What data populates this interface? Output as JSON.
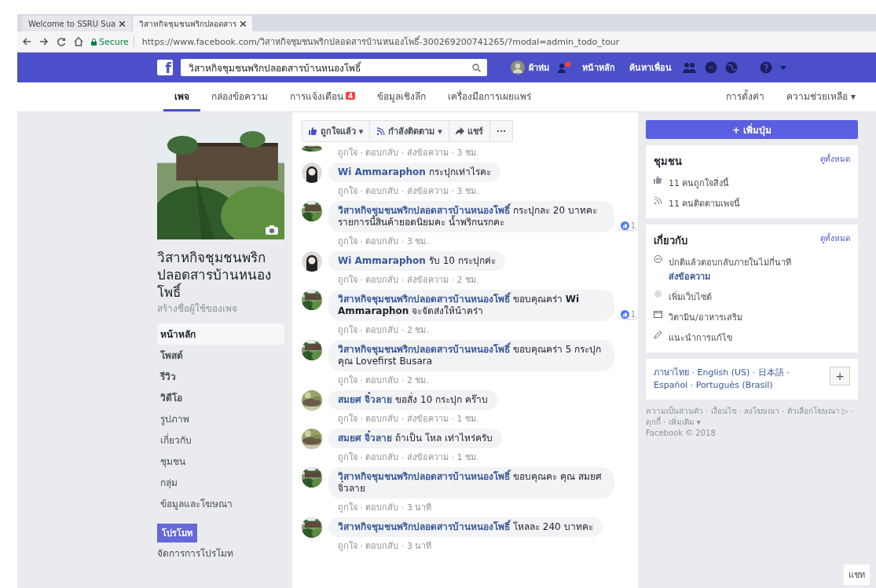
{
  "browser": {
    "tabs": [
      {
        "title": "Welcome to SSRU Sua",
        "selected": false
      },
      {
        "title": "วิสาหกิจชุมชนพริกปลอดสาร",
        "selected": true
      }
    ],
    "secure_label": "Secure",
    "url": "https://www.facebook.com/วิสาหกิจชุมชนพริกปลอดสารบ้านหนองโพธิ์-300269200741265/?modal=admin_todo_tour"
  },
  "topbar": {
    "logo": "f",
    "search_value": "วิสาหกิจชุมชนพริกปลอดสารบ้านหนองโพธิ์",
    "user": "ผ้าห่ม",
    "links": [
      "หน้าหลัก",
      "ค้นหาเพื่อน"
    ]
  },
  "page_tabs": [
    {
      "label": "เพจ",
      "selected": true
    },
    {
      "label": "กล่องข้อความ",
      "selected": false
    },
    {
      "label": "การแจ้งเตือน",
      "selected": false,
      "badge": "4"
    },
    {
      "label": "ข้อมูลเชิงลึก",
      "selected": false
    },
    {
      "label": "เครื่องมือการเผยแพร่",
      "selected": false
    }
  ],
  "page_tabs_right": [
    "การตั้งค่า",
    "ความช่วยเหลือ ▾"
  ],
  "sidebar": {
    "page_name": "วิสาหกิจชุมชนพริกปลอดสารบ้านหนองโพธิ์",
    "username_hint": "สร้างชื่อผู้ใช้ของเพจ",
    "items": [
      {
        "label": "หน้าหลัก",
        "selected": true
      },
      {
        "label": "โพสต์",
        "selected": false
      },
      {
        "label": "รีวิว",
        "selected": false
      },
      {
        "label": "วิดีโอ",
        "selected": false
      },
      {
        "label": "รูปภาพ",
        "selected": false
      },
      {
        "label": "เกี่ยวกับ",
        "selected": false
      },
      {
        "label": "ชุมชน",
        "selected": false
      },
      {
        "label": "กลุ่ม",
        "selected": false
      },
      {
        "label": "ข้อมูลและโฆษณา",
        "selected": false
      }
    ],
    "promote_button": "โปรโมท",
    "manage_promotions": "จัดการการโปรโมท"
  },
  "actions": [
    {
      "kind": "like",
      "label": "ถูกใจแล้ว ▾"
    },
    {
      "kind": "follow",
      "label": "กำลังติดตาม ▾"
    },
    {
      "kind": "share",
      "label": "แชร์"
    },
    {
      "kind": "more",
      "label": "···"
    }
  ],
  "comments": [
    {
      "kind": "page",
      "meta": "ถูกใจ · ตอบกลับ · ส่งข้อความ · 3 ชม."
    },
    {
      "kind": "person",
      "author": "Wi Ammaraphon",
      "text": "กระปุกเท่าไรคะ",
      "meta": "ถูกใจ · ตอบกลับ · ส่งข้อความ · 3 ชม."
    },
    {
      "kind": "page",
      "author": "วิสาหกิจชุมชนพริกปลอดสารบ้านหนองโพธิ์",
      "text": "กระปุกละ 20 บาทคะ รายการนี้สินค้ายอดนิยมคะ น้ำพริกนรกคะ",
      "meta": "ถูกใจ · ตอบกลับ · 3 ชม.",
      "likes": "1"
    },
    {
      "kind": "person",
      "author": "Wi Ammaraphon",
      "text": "รับ 10 กระปุกค่ะ",
      "meta": "ถูกใจ · ตอบกลับ · ส่งข้อความ · 2 ชม."
    },
    {
      "kind": "page",
      "author": "วิสาหกิจชุมชนพริกปลอดสารบ้านหนองโพธิ์",
      "text": "ขอบคุณคร่า **Wi Ammaraphon** จะจัดส่งให้น้าคร่า",
      "meta": "ถูกใจ · ตอบกลับ · 2 ชม.",
      "likes": "1"
    },
    {
      "kind": "page",
      "author": "วิสาหกิจชุมชนพริกปลอดสารบ้านหนองโพธิ์",
      "text": "ขอบคุณคร่า 5 กระปุก คุณ Lovefirst Busara",
      "meta": "ถูกใจ · ตอบกลับ · 2 ชม."
    },
    {
      "kind": "user",
      "author": "สมยศ จิ๋วลาย",
      "text": "ขอสั่ง 10 กระปุก คร๊าบ",
      "meta": "ถูกใจ · ตอบกลับ · ส่งข้อความ · 1 ชม."
    },
    {
      "kind": "user",
      "author": "สมยศ จิ๋วลาย",
      "text": "ถ้าเป็น โหล เท่าไหร่ครับ",
      "meta": "ถูกใจ · ตอบกลับ · ส่งข้อความ · 1 ชม."
    },
    {
      "kind": "page",
      "author": "วิสาหกิจชุมชนพริกปลอดสารบ้านหนองโพธิ์",
      "text": "ขอบคุณคะ คุณ สมยศ จิ๋วลาย",
      "meta": "ถูกใจ · ตอบกลับ · 3 นาที"
    },
    {
      "kind": "page",
      "author": "วิสาหกิจชุมชนพริกปลอดสารบ้านหนองโพธิ์",
      "text": "โหลละ 240 บาทคะ",
      "meta": "ถูกใจ · ตอบกลับ · 3 นาที"
    }
  ],
  "right": {
    "add_button": "+ เพิ่มปุ่ม",
    "cards": [
      {
        "title": "ชุมชน",
        "see_all": "ดูทั้งหมด",
        "rows": [
          {
            "kind": "like",
            "text": "11 คนถูกใจสิ่งนี้"
          },
          {
            "kind": "follow",
            "text": "11 คนติดตามเพจนี้"
          }
        ]
      },
      {
        "title": "เกี่ยวกับ",
        "see_all": "ดูทั้งหมด",
        "rows": [
          {
            "kind": "message",
            "text": "ปกติแล้วตอบกลับภายในไม่กี่นาที",
            "link": "ส่งข้อความ"
          },
          {
            "kind": "web",
            "text": "เพิ่มเว็บไซต์"
          },
          {
            "kind": "category",
            "text": "วิตามิน/อาหารเสริม"
          },
          {
            "kind": "edit",
            "text": "แนะนำการแก้ไข"
          }
        ]
      }
    ],
    "languages": "ภาษาไทย · English (US) · 日本語 · Español · Português (Brasil)",
    "language_add": "+",
    "footer": "ความเป็นส่วนตัว · เงื่อนไข · ลงโฆษณา · ตัวเลือกโฆษณา ▷ · คุกกี้ · เพิ่มเติม ▾",
    "copyright": "Facebook © 2018"
  },
  "chat": "แชท"
}
